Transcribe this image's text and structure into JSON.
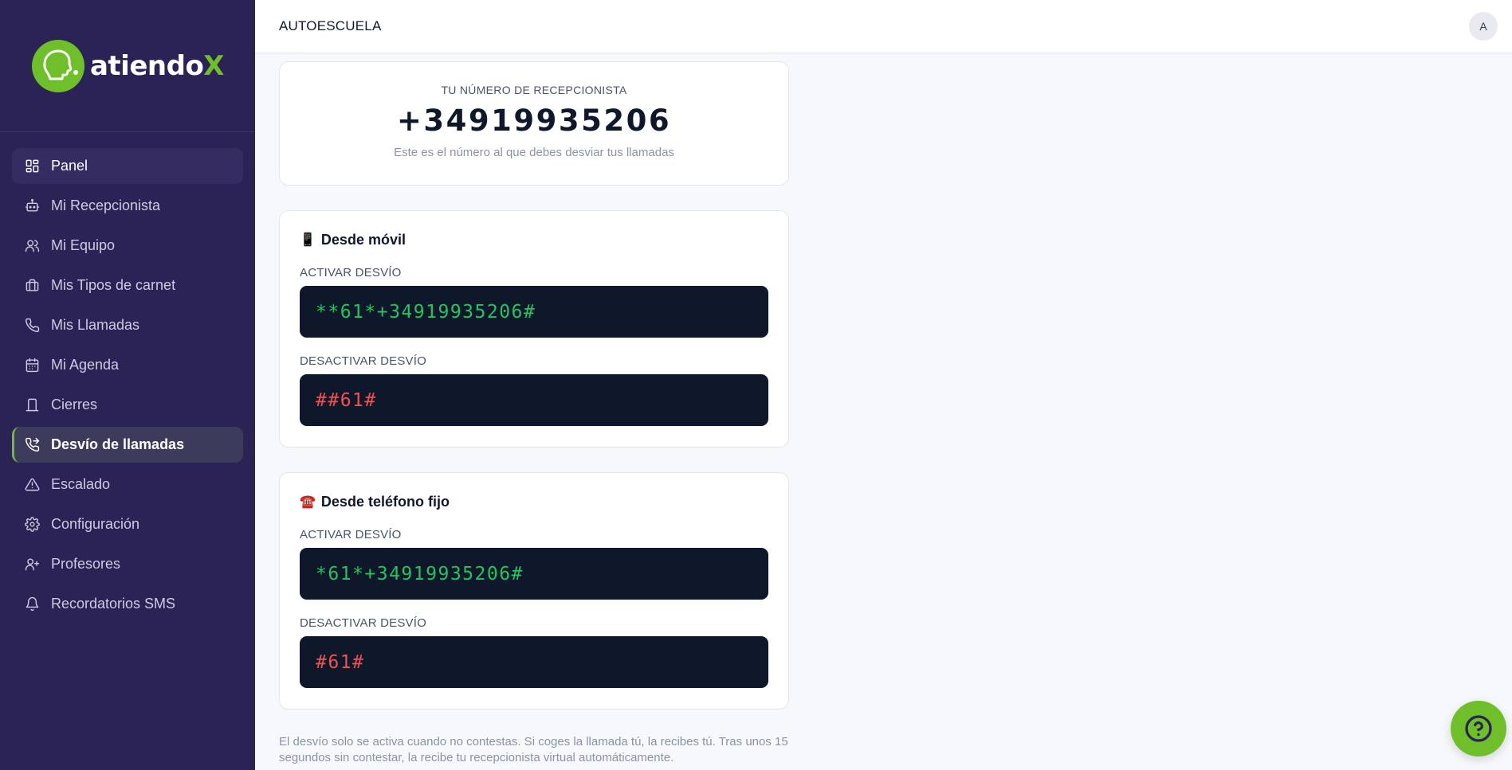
{
  "brand": {
    "name_main": "atiendo",
    "name_accent": "X",
    "accent_color": "#6fbf2a",
    "sidebar_color": "#2b2255"
  },
  "sidebar": {
    "items": [
      {
        "label": "Panel",
        "icon": "grid-icon"
      },
      {
        "label": "Mi Recepcionista",
        "icon": "robot-icon"
      },
      {
        "label": "Mi Equipo",
        "icon": "users-icon"
      },
      {
        "label": "Mis Tipos de carnet",
        "icon": "briefcase-icon"
      },
      {
        "label": "Mis Llamadas",
        "icon": "phone-icon"
      },
      {
        "label": "Mi Agenda",
        "icon": "calendar-icon"
      },
      {
        "label": "Cierres",
        "icon": "closure-icon"
      },
      {
        "label": "Desvío de llamadas",
        "icon": "phone-forward-icon"
      },
      {
        "label": "Escalado",
        "icon": "alert-triangle-icon"
      },
      {
        "label": "Configuración",
        "icon": "gear-icon"
      },
      {
        "label": "Profesores",
        "icon": "user-plus-icon"
      },
      {
        "label": "Recordatorios SMS",
        "icon": "bell-icon"
      }
    ],
    "active_index": 7
  },
  "header": {
    "org_name": "AUTOESCUELA",
    "avatar_initial": "A"
  },
  "receptionist": {
    "label": "TU NÚMERO DE RECEPCIONISTA",
    "number": "+34919935206",
    "hint": "Este es el número al que debes desviar tus llamadas"
  },
  "mobile": {
    "emoji": "📱",
    "title": "Desde móvil",
    "activate_label": "ACTIVAR DESVÍO",
    "activate_code": "**61*+34919935206#",
    "deactivate_label": "DESACTIVAR DESVÍO",
    "deactivate_code": "##61#"
  },
  "landline": {
    "emoji": "☎️",
    "title": "Desde teléfono fijo",
    "activate_label": "ACTIVAR DESVÍO",
    "activate_code": "*61*+34919935206#",
    "deactivate_label": "DESACTIVAR DESVÍO",
    "deactivate_code": "#61#"
  },
  "footnote": "El desvío solo se activa cuando no contestas. Si coges la llamada tú, la recibes tú. Tras unos 15 segundos sin contestar, la recibe tu recepcionista virtual automáticamente.",
  "help": {
    "icon": "help-circle-icon"
  }
}
